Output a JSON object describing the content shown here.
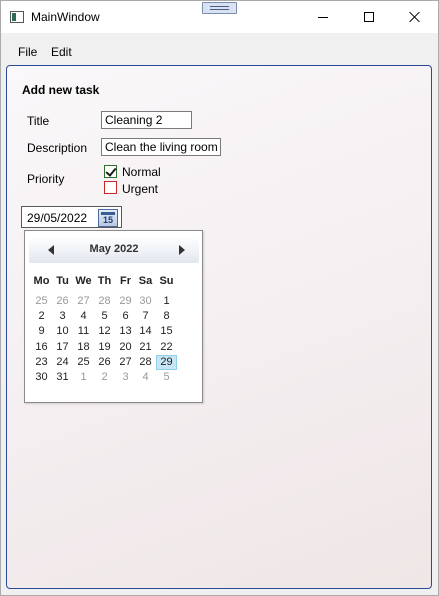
{
  "window": {
    "title": "MainWindow"
  },
  "menu": {
    "file": "File",
    "edit": "Edit"
  },
  "form": {
    "heading": "Add new task",
    "title_label": "Title",
    "title_value": "Cleaning 2",
    "description_label": "Description",
    "description_value": "Clean the living room",
    "priority_label": "Priority",
    "priority_options": [
      {
        "label": "Normal",
        "checked": true,
        "color": "#2f6e2f"
      },
      {
        "label": "Urgent",
        "checked": false,
        "color": "#c62828"
      }
    ],
    "date_value": "29/05/2022",
    "calendar_button_text": "15"
  },
  "calendar": {
    "month_label": "May 2022",
    "weekdays": [
      "Mo",
      "Tu",
      "We",
      "Th",
      "Fr",
      "Sa",
      "Su"
    ],
    "weeks": [
      [
        [
          "25",
          true
        ],
        [
          "26",
          true
        ],
        [
          "27",
          true
        ],
        [
          "28",
          true
        ],
        [
          "29",
          true
        ],
        [
          "30",
          true
        ],
        [
          "1",
          false
        ]
      ],
      [
        [
          "2",
          false
        ],
        [
          "3",
          false
        ],
        [
          "4",
          false
        ],
        [
          "5",
          false
        ],
        [
          "6",
          false
        ],
        [
          "7",
          false
        ],
        [
          "8",
          false
        ]
      ],
      [
        [
          "9",
          false
        ],
        [
          "10",
          false
        ],
        [
          "11",
          false
        ],
        [
          "12",
          false
        ],
        [
          "13",
          false
        ],
        [
          "14",
          false
        ],
        [
          "15",
          false
        ]
      ],
      [
        [
          "16",
          false
        ],
        [
          "17",
          false
        ],
        [
          "18",
          false
        ],
        [
          "19",
          false
        ],
        [
          "20",
          false
        ],
        [
          "21",
          false
        ],
        [
          "22",
          false
        ]
      ],
      [
        [
          "23",
          false
        ],
        [
          "24",
          false
        ],
        [
          "25",
          false
        ],
        [
          "26",
          false
        ],
        [
          "27",
          false
        ],
        [
          "28",
          false
        ],
        [
          "29",
          false
        ]
      ],
      [
        [
          "30",
          false
        ],
        [
          "31",
          false
        ],
        [
          "1",
          true
        ],
        [
          "2",
          true
        ],
        [
          "3",
          true
        ],
        [
          "4",
          true
        ],
        [
          "5",
          true
        ]
      ]
    ],
    "selected": {
      "week": 4,
      "day": 6
    },
    "accent": "#c7e6f5"
  }
}
